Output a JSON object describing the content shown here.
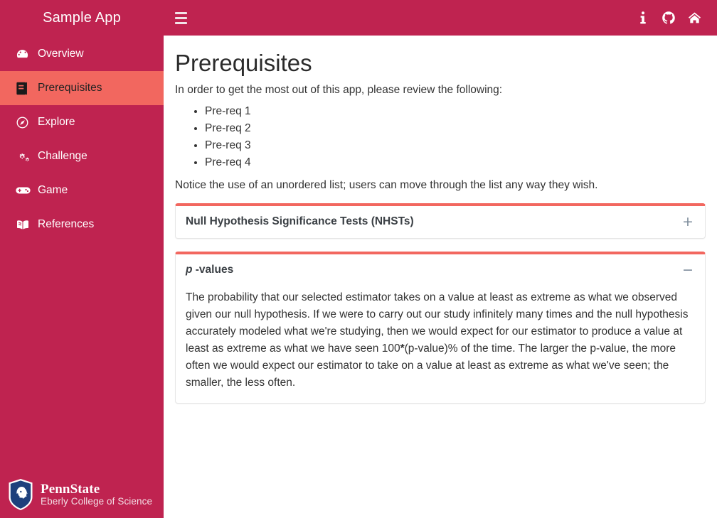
{
  "sidebar": {
    "brand": "Sample App",
    "items": [
      {
        "label": "Overview",
        "icon": "tachometer-icon",
        "active": false
      },
      {
        "label": "Prerequisites",
        "icon": "book-icon",
        "active": true
      },
      {
        "label": "Explore",
        "icon": "compass-icon",
        "active": false
      },
      {
        "label": "Challenge",
        "icon": "cogs-icon",
        "active": false
      },
      {
        "label": "Game",
        "icon": "gamepad-icon",
        "active": false
      },
      {
        "label": "References",
        "icon": "book-open-icon",
        "active": false
      }
    ],
    "logo": {
      "name": "PennState",
      "subtitle": "Eberly College of Science"
    }
  },
  "topbar": {
    "menu_icon": "hamburger-icon",
    "actions": [
      {
        "icon": "info-icon",
        "name": "info-button"
      },
      {
        "icon": "github-icon",
        "name": "github-button"
      },
      {
        "icon": "home-icon",
        "name": "home-button"
      }
    ]
  },
  "main": {
    "title": "Prerequisites",
    "lead": "In order to get the most out of this app, please review the following:",
    "prereqs": [
      "Pre-req 1",
      "Pre-req 2",
      "Pre-req 3",
      "Pre-req 4"
    ],
    "note": "Notice the use of an unordered list; users can move through the list any way they wish.",
    "accordion": [
      {
        "title": "Null Hypothesis Significance Tests (NHSTs)",
        "expanded": false,
        "toggle": "+",
        "body": ""
      },
      {
        "title_italic": "p",
        "title_rest": " -values",
        "expanded": true,
        "toggle": "−",
        "body_part1": "The probability that our selected estimator takes on a value at least as extreme as what we observed given our null hypothesis. If we were to carry out our study infinitely many times and the null hypothesis accurately modeled what we're studying, then we would expect for our estimator to produce a value at least as extreme as what we have seen 100",
        "body_bold": "*",
        "body_part2": "(p-value)% of the time. The larger the p-value, the more often we would expect our estimator to take on a value at least as extreme as what we've seen; the smaller, the less often."
      }
    ]
  },
  "colors": {
    "brand_red": "#bf2350",
    "accent_coral": "#f2675f",
    "active_border": "#a8503f",
    "toggle_gray": "#7b8a9a",
    "shield_blue": "#1e407c"
  }
}
